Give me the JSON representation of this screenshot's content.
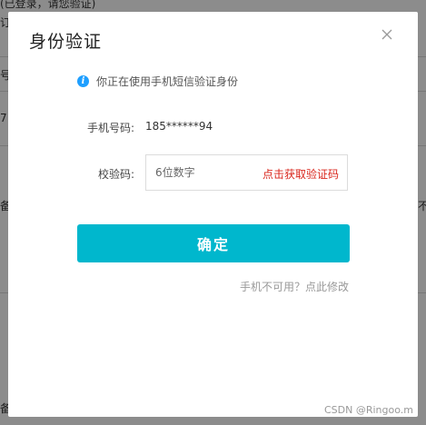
{
  "background": {
    "snippets": [
      {
        "text": "(已登录，请您验证)"
      },
      {
        "text": "订"
      },
      {
        "text": "号"
      },
      {
        "text": "7"
      },
      {
        "text": "备"
      },
      {
        "text": "不"
      },
      {
        "text": "备"
      }
    ]
  },
  "dialog": {
    "title": "身份验证",
    "close_icon": "close-icon",
    "notice": {
      "icon": "info-icon",
      "icon_glyph": "i",
      "text": "你正在使用手机短信验证身份"
    },
    "phone": {
      "label": "手机号码:",
      "value": "185******94"
    },
    "code": {
      "label": "校验码:",
      "placeholder": "6位数字",
      "get_code_label": "点击获取验证码"
    },
    "confirm_label": "确定",
    "alt_link": "手机不可用？点此修改"
  },
  "watermark": "CSDN @Ringoo.m",
  "colors": {
    "accent": "#00b7cd",
    "link_red": "#d9261c",
    "info_blue": "#1e9fff"
  }
}
